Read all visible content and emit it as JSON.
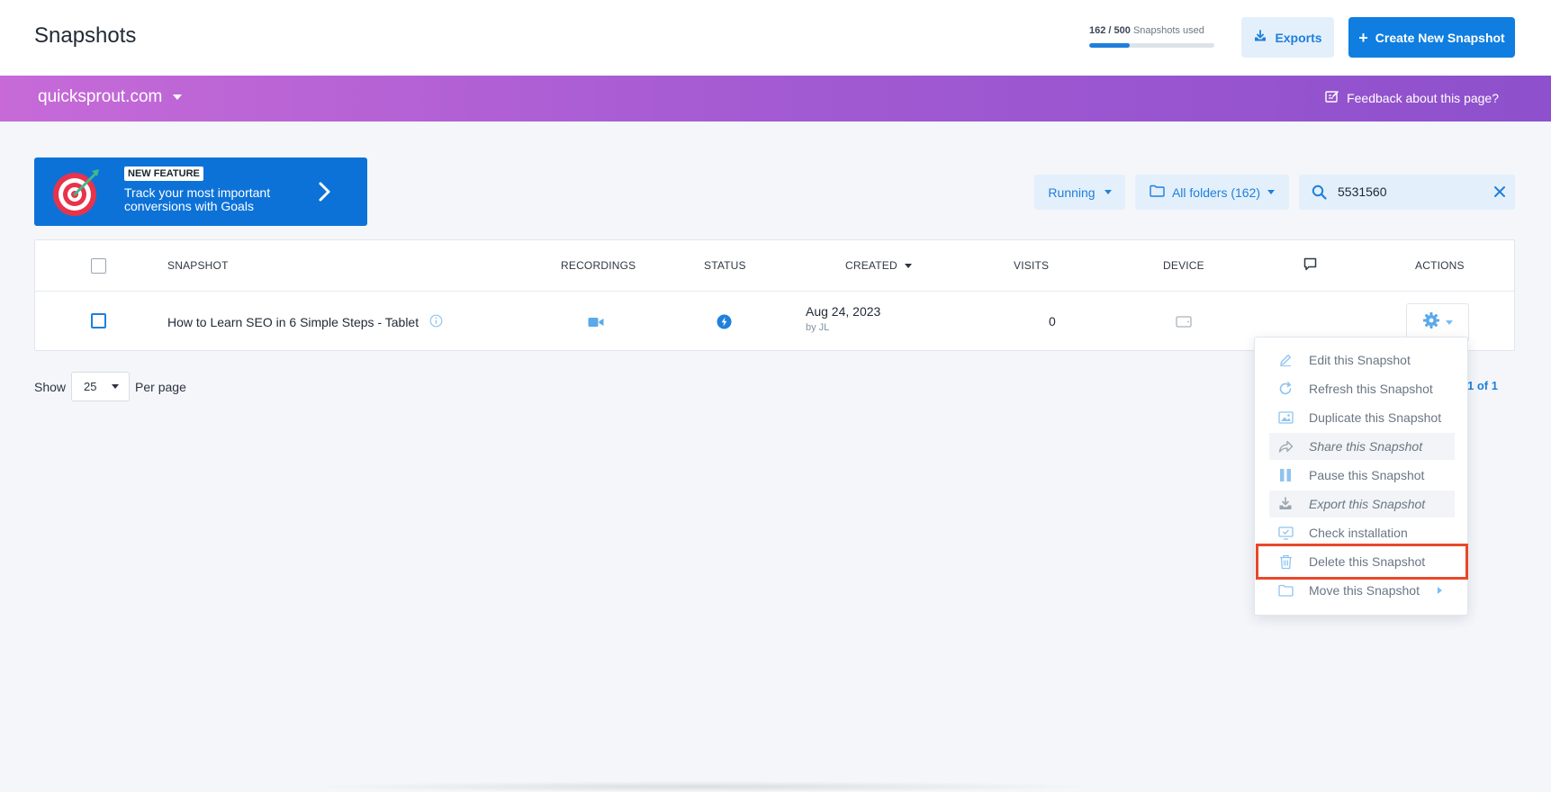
{
  "header": {
    "title": "Snapshots",
    "usage_used": "162 / 500",
    "usage_suffix": "Snapshots used",
    "usage_fraction": 0.324,
    "exports_label": "Exports",
    "create_label": "Create New Snapshot"
  },
  "sitebar": {
    "site": "quicksprout.com",
    "feedback": "Feedback about this page?"
  },
  "promo": {
    "badge": "NEW FEATURE",
    "text": "Track your most important conversions with Goals"
  },
  "filters": {
    "status": "Running",
    "folders": "All folders (162)",
    "search_value": "5531560"
  },
  "table": {
    "columns": {
      "snapshot": "SNAPSHOT",
      "recordings": "RECORDINGS",
      "status": "STATUS",
      "created": "CREATED",
      "visits": "VISITS",
      "device": "DEVICE",
      "actions": "ACTIONS"
    },
    "rows": [
      {
        "name": "How to Learn SEO in 6 Simple Steps - Tablet",
        "created": "Aug 24, 2023",
        "created_by": "by JL",
        "visits": "0"
      }
    ]
  },
  "pagination": {
    "show": "Show",
    "per_page_value": "25",
    "per_page": "Per page",
    "page_prefix": "1 of",
    "page_total": "1"
  },
  "actions_menu": {
    "items": [
      {
        "label": "Edit this Snapshot",
        "icon": "pencil-icon"
      },
      {
        "label": "Refresh this Snapshot",
        "icon": "refresh-icon"
      },
      {
        "label": "Duplicate this Snapshot",
        "icon": "duplicate-icon"
      },
      {
        "label": "Share this Snapshot",
        "icon": "share-icon"
      },
      {
        "label": "Pause this Snapshot",
        "icon": "pause-icon"
      },
      {
        "label": "Export this Snapshot",
        "icon": "export-icon"
      },
      {
        "label": "Check installation",
        "icon": "monitor-check-icon"
      },
      {
        "label": "Delete this Snapshot",
        "icon": "trash-icon"
      },
      {
        "label": "Move this Snapshot",
        "icon": "folder-icon"
      }
    ]
  },
  "colors": {
    "accent": "#1f7fdc",
    "highlight": "#e8482b",
    "purple_start": "#c76ad8",
    "purple_end": "#8e50cc"
  }
}
